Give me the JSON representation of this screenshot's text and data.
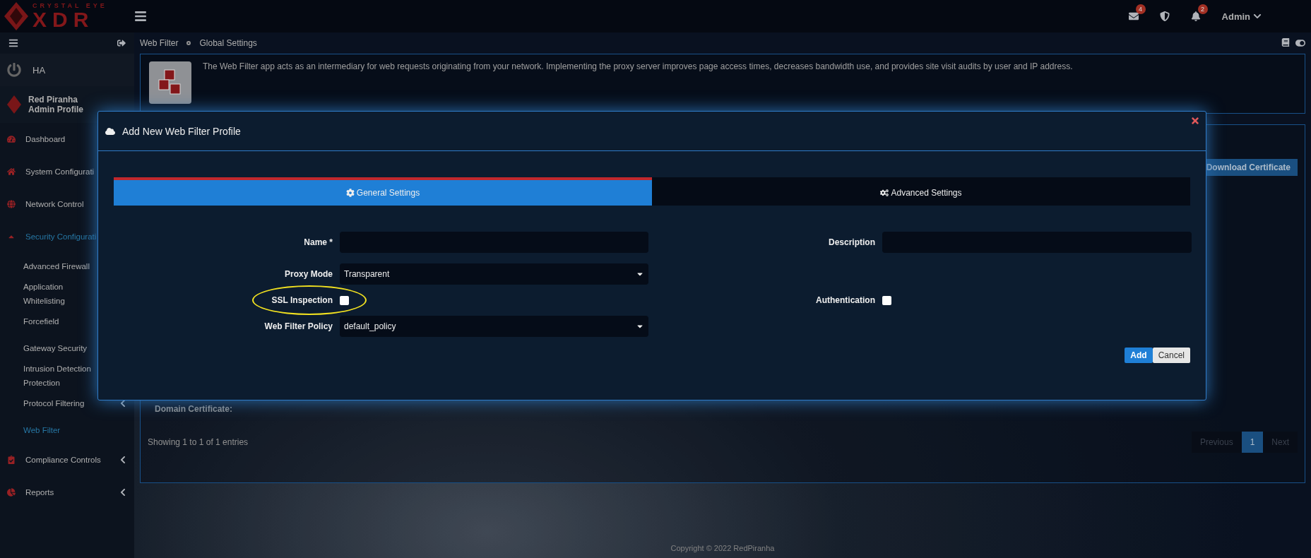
{
  "header": {
    "logo_top": "CRYSTAL EYE",
    "logo_main": "XDR",
    "mail_count": "4",
    "alert_count": "2",
    "user": "Admin"
  },
  "sidebar": {
    "ha": "HA",
    "profile_name": "Red Piranha",
    "profile_role": "Admin Profile",
    "items": [
      {
        "label": "Dashboard",
        "selected": false,
        "expanded": false
      },
      {
        "label": "System Configurati",
        "selected": false,
        "expanded": false
      },
      {
        "label": "Network Control",
        "selected": false,
        "expanded": false
      },
      {
        "label": "Security Configurati",
        "selected": true,
        "expanded": true,
        "children": [
          {
            "label": "Advanced Firewall",
            "selected": false
          },
          {
            "label": "Application Whitelisting",
            "selected": false
          },
          {
            "label": "Forcefield",
            "selected": false
          },
          {
            "label": "Gateway Security",
            "selected": false
          },
          {
            "label": "Intrusion Detection Protection",
            "selected": false
          },
          {
            "label": "Protocol Filtering",
            "selected": false,
            "has_submenu": true
          },
          {
            "label": "Web Filter",
            "selected": true,
            "has_submenu": false
          }
        ]
      },
      {
        "label": "Compliance Controls",
        "selected": false,
        "expanded": false,
        "has_submenu": true
      },
      {
        "label": "Reports",
        "selected": false,
        "expanded": false,
        "has_submenu": true
      }
    ]
  },
  "breadcrumb": [
    "Web Filter",
    "Global Settings"
  ],
  "info": "The Web Filter app acts as an intermediary for web requests originating from your network. Implementing the proxy server improves page access times, decreases bandwidth use, and provides site visit audits by user and IP address.",
  "panel": {
    "download_button": "Download Certificate",
    "domain_certificate": "Domain Certificate:",
    "showing": "Showing 1 to 1 of 1 entries",
    "pagination": [
      {
        "label": "Previous",
        "selected": false
      },
      {
        "label": "1",
        "selected": true
      },
      {
        "label": "Next",
        "selected": false
      }
    ]
  },
  "footer": "Copyright © 2022 RedPiranha",
  "modal": {
    "title": "Add New Web Filter Profile",
    "tabs": [
      {
        "label": "General Settings",
        "selected": true
      },
      {
        "label": "Advanced Settings",
        "selected": false
      }
    ],
    "rows": [
      {
        "left": {
          "kind": "text",
          "label": "Name *"
        },
        "right": {
          "kind": "text",
          "label": "Description"
        }
      },
      {
        "left": {
          "kind": "select",
          "label": "Proxy Mode",
          "value": "Transparent"
        }
      },
      {
        "left": {
          "kind": "checkbox",
          "label": "SSL Inspection",
          "checked": false,
          "highlighted": true
        },
        "right": {
          "kind": "checkbox",
          "label": "Authentication",
          "checked": false
        }
      },
      {
        "left": {
          "kind": "select",
          "label": "Web Filter Policy",
          "value": "default_policy"
        }
      }
    ],
    "buttons": [
      {
        "label": "Add",
        "kind": "primary"
      },
      {
        "label": "Cancel",
        "kind": "secondary"
      }
    ]
  }
}
